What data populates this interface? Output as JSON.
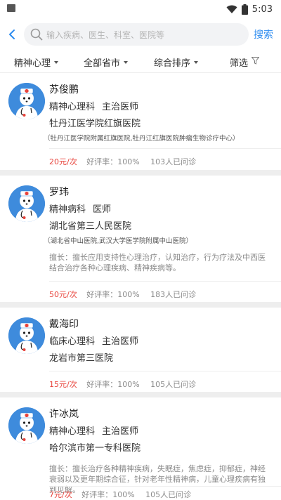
{
  "status": {
    "time": "5:03"
  },
  "search": {
    "placeholder": "输入疾病、医生、科室、医院等",
    "button": "搜索"
  },
  "filters": [
    {
      "label": "精神心理"
    },
    {
      "label": "全部省市"
    },
    {
      "label": "综合排序"
    },
    {
      "label": "筛选"
    }
  ],
  "doctors": [
    {
      "name": "苏俊鹏",
      "department": "精神心理科",
      "title": "主治医师",
      "hospital": "牡丹江医学院红旗医院",
      "hospital_note": "（牡丹江医学院附属红旗医院,牡丹江红旗医院肿瘤生物诊疗中心）",
      "specialty": "",
      "price": "20元/次",
      "rating": "好评率：100%",
      "consults": "103人已问诊"
    },
    {
      "name": "罗玮",
      "department": "精神病科",
      "title": "医师",
      "hospital": "湖北省第三人民医院",
      "hospital_note": "（湖北省中山医院,武汉大学医学院附属中山医院）",
      "specialty": "擅长：擅长应用支持性心理治疗，认知治疗，行为疗法及中西医结合治疗各种心理疾病、精神疾病等。",
      "price": "50元/次",
      "rating": "好评率：100%",
      "consults": "183人已问诊"
    },
    {
      "name": "戴海印",
      "department": "临床心理科",
      "title": "主治医师",
      "hospital": "龙岩市第三医院",
      "hospital_note": "",
      "specialty": "",
      "price": "15元/次",
      "rating": "好评率：100%",
      "consults": "105人已问诊"
    },
    {
      "name": "许冰岚",
      "department": "精神心理科",
      "title": "主治医师",
      "hospital": "哈尔滨市第一专科医院",
      "hospital_note": "",
      "specialty": "擅长：擅长治疗各种精神疾病，失眠症，焦虑症，抑郁症，神经衰弱以及更年期综合征，针对老年性精神病，儿童心理疾病有独到见解。",
      "price": "7元/次",
      "rating": "好评率：100%",
      "consults": "105人已问诊"
    }
  ]
}
